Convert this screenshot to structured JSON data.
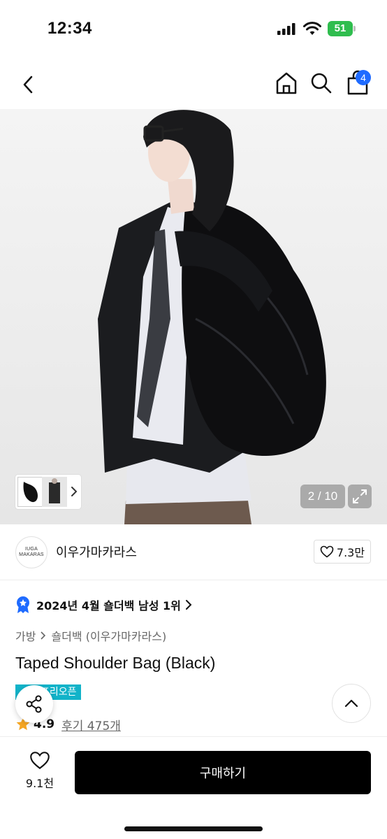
{
  "status_bar": {
    "time": "12:34",
    "battery": "51"
  },
  "nav": {
    "cart_badge": "4"
  },
  "gallery": {
    "counter": "2 / 10"
  },
  "brand": {
    "logo_line1": "IUGA",
    "logo_line2": "MAKARAS",
    "name": "이우가마카라스",
    "likes": "7.3만"
  },
  "ranking": {
    "text": "2024년 4월 숄더백 남성 1위"
  },
  "breadcrumb": {
    "items": [
      "가방",
      "숄더백 (이우가마카라스)"
    ]
  },
  "product": {
    "title": "Taped Shoulder Bag (Black)",
    "tag": "프리오픈",
    "rating": "4.9",
    "review_link": "후기 475개"
  },
  "bottom": {
    "wish_count": "9.1천",
    "buy_label": "구매하기"
  },
  "colors": {
    "accent_blue": "#1f6bff",
    "tag_cyan": "#12b3c9",
    "battery_green": "#2fbd4e",
    "star": "#f5a623"
  }
}
